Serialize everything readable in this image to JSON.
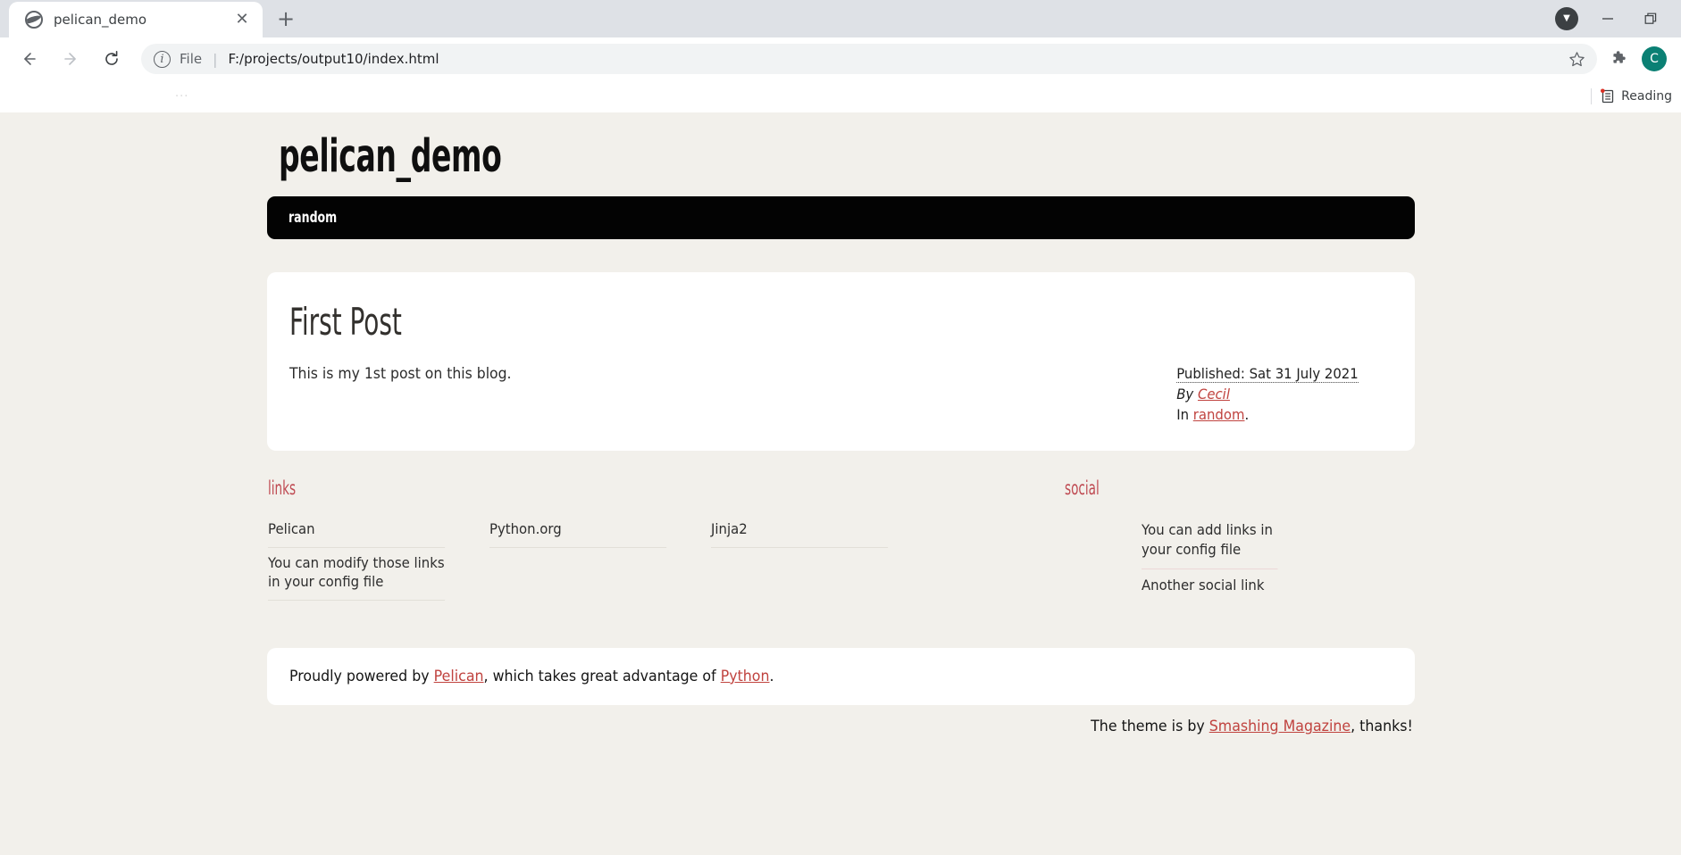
{
  "browser": {
    "tab": {
      "title": "pelican_demo",
      "favicon_name": "globe-icon",
      "close_label": "✕"
    },
    "new_tab_label": "+",
    "window_controls": {
      "profile_label": "▼",
      "minimize_label": "—",
      "restore_label": "❐"
    },
    "toolbar": {
      "back_label": "←",
      "forward_label": "→",
      "reload_label": "↻",
      "info_label": "i",
      "scheme_label": "File",
      "separator": "|",
      "url": "F:/projects/output10/index.html",
      "star_label": "☆",
      "extensions_label": "puzzle-piece",
      "avatar_label": "C"
    },
    "bookmarks": {
      "placeholder_dots": "···",
      "reading_list_label": "Reading"
    }
  },
  "site": {
    "title": "pelican_demo",
    "nav": [
      {
        "label": "random"
      }
    ]
  },
  "article": {
    "title": "First Post",
    "body": "This is my 1st post on this blog.",
    "meta": {
      "published_prefix": "Published:",
      "published_date": "Sat 31 July 2021",
      "by_label": "By",
      "author": "Cecil",
      "in_label": "In",
      "category": "random",
      "period": "."
    }
  },
  "widgets": {
    "links": {
      "heading": "links",
      "items": [
        {
          "label": "Pelican"
        },
        {
          "label": "Python.org"
        },
        {
          "label": "Jinja2"
        },
        {
          "label": "You can modify those links in your config file"
        }
      ]
    },
    "social": {
      "heading": "social",
      "items": [
        {
          "label": "You can add links in your config file"
        },
        {
          "label": "Another social link"
        }
      ]
    }
  },
  "footer": {
    "prefix": "Proudly powered by",
    "link1": "Pelican",
    "middle": ", which takes great advantage of",
    "link2": "Python",
    "suffix": ".",
    "theme_prefix": "The theme is by",
    "theme_link": "Smashing Magazine",
    "theme_suffix": ", thanks!"
  },
  "colors": {
    "page_background": "#f2f0eb",
    "card_background": "#ffffff",
    "nav_background": "#030303",
    "accent_red": "#c0433f",
    "heading_red": "#bf4a52"
  }
}
